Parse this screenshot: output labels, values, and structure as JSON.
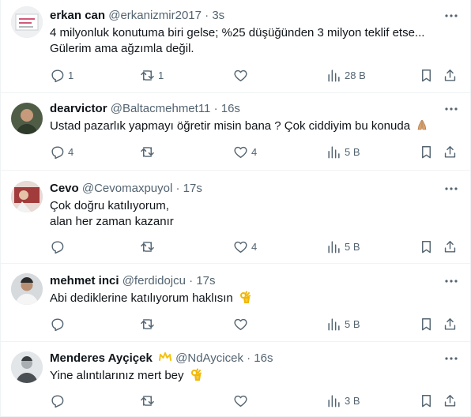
{
  "tweets": [
    {
      "name": "erkan can",
      "handle": "@erkanizmir2017",
      "separator": "·",
      "time": "3s",
      "lines": [
        "4 milyonluk konutuma biri gelse; %25 düşüğünden 3 milyon teklif etse...",
        "Gülerim ama ağzımla değil."
      ],
      "replies": "1",
      "retweets": "1",
      "likes": "",
      "views": "28 B",
      "emoji": "",
      "avatar_color": "#d8dde0"
    },
    {
      "name": "dearvictor",
      "handle": "@Baltacmehmet11",
      "separator": "·",
      "time": "16s",
      "lines": [
        "Ustad pazarlık yapmayı öğretir misin bana ? Çok ciddiyim bu konuda"
      ],
      "replies": "4",
      "retweets": "",
      "likes": "4",
      "views": "5 B",
      "emoji": "folded-hands",
      "avatar_color": "#5a6b4e"
    },
    {
      "name": "Cevo",
      "handle": "@Cevomaxpuyol",
      "separator": "·",
      "time": "17s",
      "lines": [
        "Çok doğru katılıyorum,",
        "alan her zaman kazanır"
      ],
      "replies": "",
      "retweets": "",
      "likes": "4",
      "views": "5 B",
      "emoji": "",
      "avatar_color": "#a03a3a"
    },
    {
      "name": "mehmet inci",
      "handle": "@ferdidojcu",
      "separator": "·",
      "time": "17s",
      "lines": [
        "Abi dediklerine katılıyorum haklısın"
      ],
      "replies": "",
      "retweets": "",
      "likes": "",
      "views": "5 B",
      "emoji": "ok-hand",
      "avatar_color": "#8a8f94"
    },
    {
      "name": "Menderes Ayçiçek",
      "handle": "@NdAycicek",
      "separator": "·",
      "time": "16s",
      "lines": [
        "Yine alıntılarınız mert bey"
      ],
      "replies": "",
      "retweets": "",
      "likes": "",
      "views": "3 B",
      "emoji": "ok-hand",
      "avatar_color": "#6d7379",
      "badge": "crown-icon"
    }
  ],
  "colors": {
    "text": "#0f1419",
    "muted": "#536471",
    "border": "#eff3f4",
    "crown": "#f4c20d"
  }
}
